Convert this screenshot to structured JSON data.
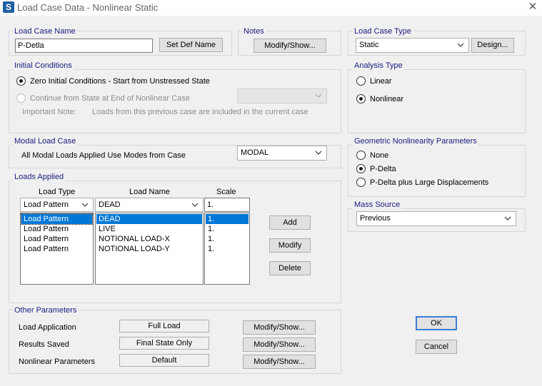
{
  "window": {
    "title": "Load Case Data - Nonlinear Static",
    "app_icon": "S"
  },
  "load_case_name": {
    "label": "Load Case Name",
    "value": "P-Detla",
    "set_def_name_button": "Set Def Name"
  },
  "notes": {
    "label": "Notes",
    "button": "Modify/Show..."
  },
  "load_case_type": {
    "label": "Load Case Type",
    "value": "Static",
    "design_button": "Design..."
  },
  "initial_conditions": {
    "label": "Initial Conditions",
    "option_zero": "Zero Initial Conditions - Start from Unstressed State",
    "option_continue": "Continue from State at End of Nonlinear Case",
    "note_label": "Important Note:",
    "note_text": "Loads from this previous case are included in the current case",
    "selected": "zero"
  },
  "analysis_type": {
    "label": "Analysis Type",
    "options": [
      "Linear",
      "Nonlinear"
    ],
    "selected": "Nonlinear"
  },
  "modal_load_case": {
    "label": "Modal Load Case",
    "text": "All Modal Loads Applied Use Modes from Case",
    "value": "MODAL"
  },
  "geometric_nonlinearity": {
    "label": "Geometric Nonlinearity Parameters",
    "options": [
      "None",
      "P-Delta",
      "P-Delta plus Large Displacements"
    ],
    "selected": "P-Delta"
  },
  "mass_source": {
    "label": "Mass Source",
    "value": "Previous"
  },
  "loads_applied": {
    "label": "Loads Applied",
    "headers": {
      "load_type": "Load Type",
      "load_name": "Load Name",
      "scale": "Scale"
    },
    "editor": {
      "load_type": "Load Pattern",
      "load_name": "DEAD",
      "scale": "1."
    },
    "rows": [
      {
        "load_type": "Load Pattern",
        "load_name": "DEAD",
        "scale": "1."
      },
      {
        "load_type": "Load Pattern",
        "load_name": "LIVE",
        "scale": "1."
      },
      {
        "load_type": "Load Pattern",
        "load_name": "NOTIONAL LOAD-X",
        "scale": "1."
      },
      {
        "load_type": "Load Pattern",
        "load_name": "NOTIONAL LOAD-Y",
        "scale": "1."
      }
    ],
    "selected_row": 0,
    "buttons": {
      "add": "Add",
      "modify": "Modify",
      "delete": "Delete"
    }
  },
  "other_parameters": {
    "label": "Other Parameters",
    "load_application": {
      "label": "Load Application",
      "value": "Full Load",
      "button": "Modify/Show..."
    },
    "results_saved": {
      "label": "Results Saved",
      "value": "Final State Only",
      "button": "Modify/Show..."
    },
    "nonlinear_parameters": {
      "label": "Nonlinear Parameters",
      "value": "Default",
      "button": "Modify/Show..."
    }
  },
  "dialog_buttons": {
    "ok": "OK",
    "cancel": "Cancel"
  },
  "colors": {
    "group_label": "#1a1a80",
    "selection": "#0078d7",
    "default_button_border": "#3a7fd5"
  }
}
